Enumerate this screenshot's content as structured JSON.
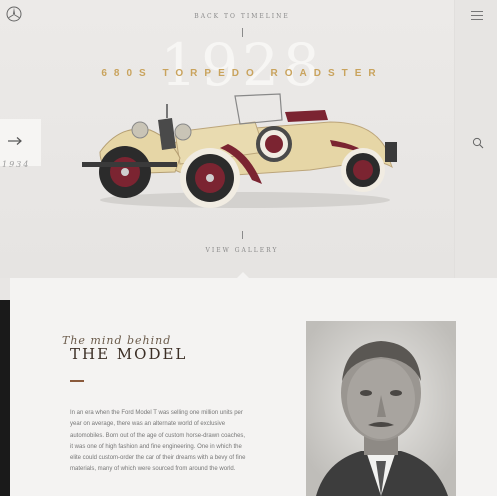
{
  "header": {
    "back_link": "BACK TO TIMELINE"
  },
  "hero": {
    "year": "1928",
    "model_name": "680S TORPEDO ROADSTER",
    "prev_year": "1934",
    "view_gallery": "VIEW GALLERY"
  },
  "icons": {
    "logo": "mercedes-star-logo",
    "menu": "hamburger-menu-icon",
    "search": "search-icon",
    "prev": "arrow-right-icon"
  },
  "about": {
    "subtitle": "The mind behind",
    "heading": "THE MODEL",
    "body": "In an era when the Ford Model T was selling one million units per year on average, there was an alternate world of exclusive automobiles. Born out of the age of custom horse-drawn coaches, it was one of high fashion and fine engineering. One in which the elite could custom-order the car of their dreams with a bevy of fine materials, many of which were sourced from around the world."
  },
  "colors": {
    "accent_gold": "#c9a35d",
    "heading_brown": "#3b2e25",
    "dash_brown": "#8a5a3c",
    "dark_strip": "#1a1a1a"
  }
}
